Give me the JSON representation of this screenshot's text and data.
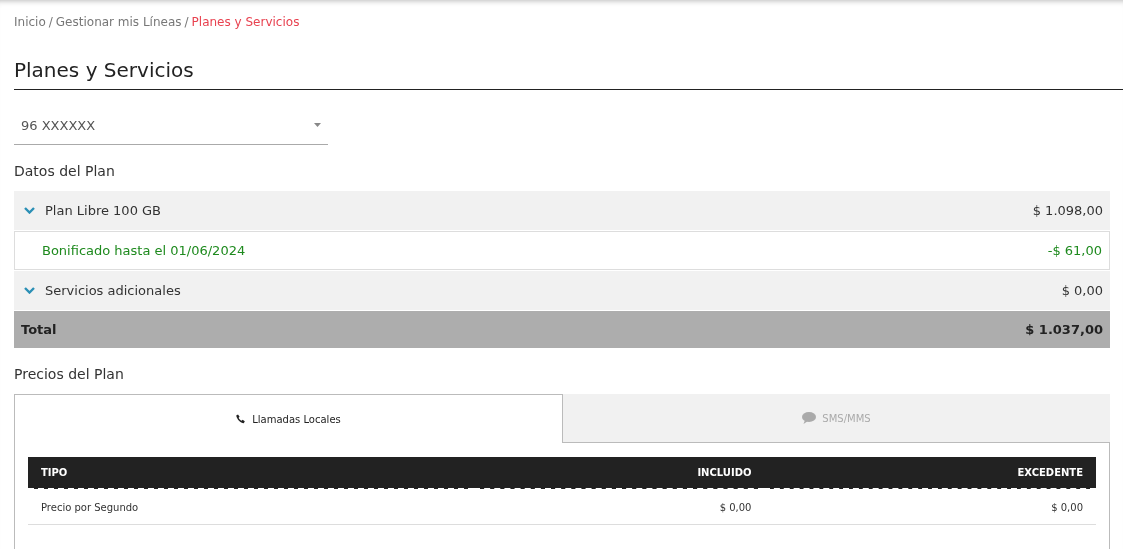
{
  "breadcrumb": [
    {
      "label": "Inicio",
      "current": false
    },
    {
      "separator": "/",
      "label": "Gestionar mis Líneas",
      "current": false
    },
    {
      "separator": "/",
      "label": "Planes y Servicios",
      "current": true
    }
  ],
  "title": "Planes y Servicios",
  "line_select": {
    "value": "96 XXXXXX"
  },
  "plan_section": {
    "title": "Datos del Plan",
    "rows": [
      {
        "kind": "group",
        "label": "Plan Libre 100 GB",
        "amount": "$ 1.098,00"
      },
      {
        "kind": "discount",
        "label": "Bonificado hasta el 01/06/2024",
        "amount": "-$ 61,00"
      },
      {
        "kind": "group",
        "label": "Servicios adicionales",
        "amount": "$ 0,00"
      },
      {
        "kind": "total",
        "label": "Total",
        "amount": "$ 1.037,00"
      }
    ]
  },
  "prices_section": {
    "title": "Precios del Plan",
    "tabs": [
      {
        "kind": "phone",
        "label": "Llamadas Locales",
        "selected": true
      },
      {
        "kind": "chat",
        "label": "SMS/MMS",
        "selected": false
      }
    ],
    "table": {
      "columns": [
        "TIPO",
        "INCLUIDO",
        "EXCEDENTE"
      ],
      "rows": [
        [
          "Precio por Segundo",
          "$ 0,00",
          "$ 0,00"
        ]
      ]
    }
  }
}
